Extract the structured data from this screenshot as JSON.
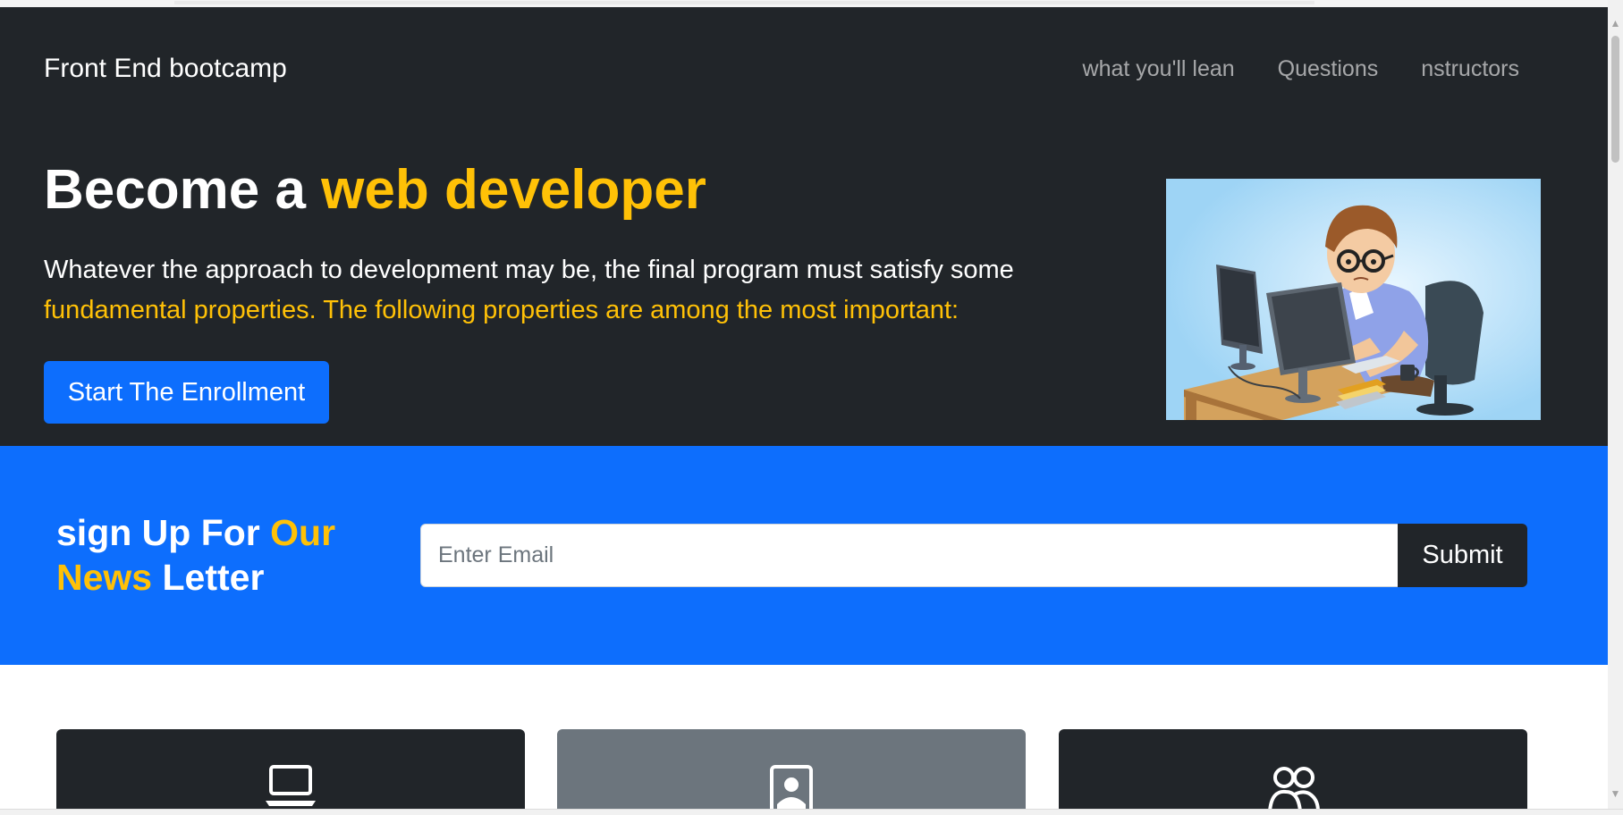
{
  "navbar": {
    "brand": "Front End bootcamp",
    "links": [
      "what you'll lean",
      "Questions",
      "nstructors"
    ]
  },
  "hero": {
    "title_plain": "Become a ",
    "title_highlight": "web developer",
    "lead_plain": "Whatever the approach to development may be, the final program must satisfy some ",
    "lead_highlight": "fundamental properties. The following properties are among the most important:",
    "button_label": "Start The Enrollment",
    "illustration": "developer-at-computer-illustration"
  },
  "newsletter": {
    "title_1": "sign Up For ",
    "title_2": "Our",
    "title_3": "News",
    "title_4": " Letter",
    "email_placeholder": "Enter Email",
    "email_value": "",
    "submit_label": "Submit"
  },
  "cards": [
    {
      "icon": "laptop-icon",
      "bg": "#212529"
    },
    {
      "icon": "person-badge-icon",
      "bg": "#6c757d"
    },
    {
      "icon": "people-icon",
      "bg": "#212529"
    }
  ],
  "colors": {
    "dark": "#212529",
    "primary": "#0d6efd",
    "accent": "#ffc107",
    "secondary": "#6c757d"
  }
}
